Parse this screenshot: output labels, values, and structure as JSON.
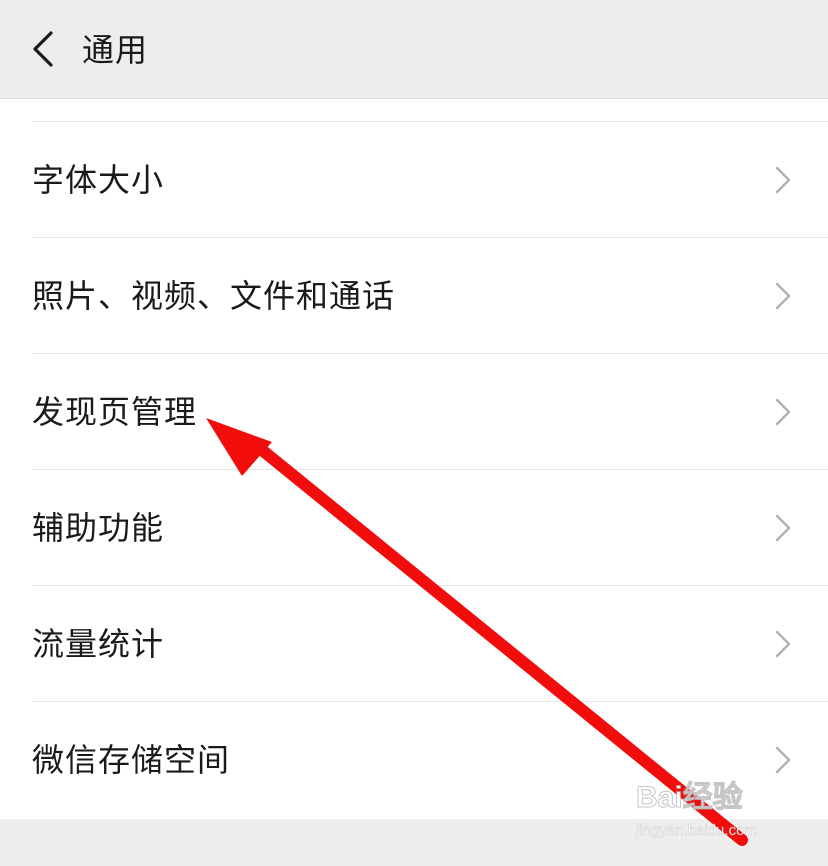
{
  "header": {
    "title": "通用",
    "back_icon": "chevron-left-icon"
  },
  "settings": {
    "items": [
      {
        "label": "字体大小"
      },
      {
        "label": "照片、视频、文件和通话"
      },
      {
        "label": "发现页管理"
      },
      {
        "label": "辅助功能"
      },
      {
        "label": "流量统计"
      },
      {
        "label": "微信存储空间"
      }
    ]
  },
  "colors": {
    "header_bg": "#ededed",
    "list_bg": "#ffffff",
    "text": "#1a1a1a",
    "chevron": "#b2b2b2",
    "divider": "#e6e6e6",
    "annotation_arrow": "#f20d0d"
  },
  "watermark": {
    "brand": "Bai经验",
    "url": "jingyan.baidu.com"
  }
}
